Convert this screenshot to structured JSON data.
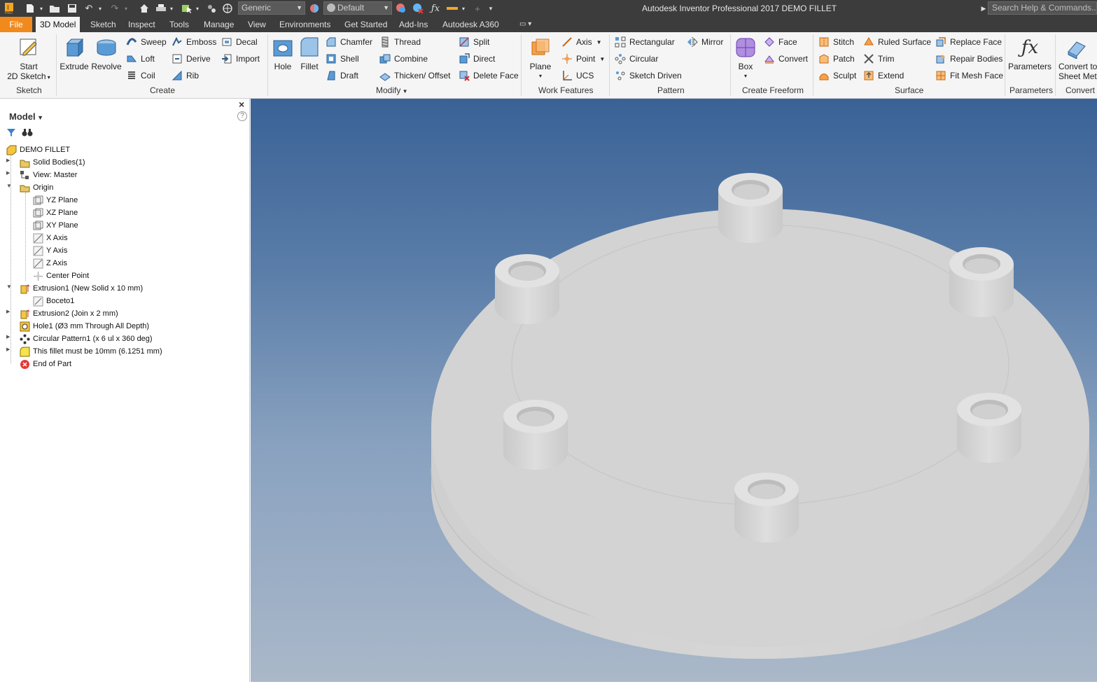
{
  "titlebar": {
    "title": "Autodesk Inventor Professional 2017   DEMO FILLET",
    "material_combo": "Generic",
    "appearance_combo": "Default",
    "search_placeholder": "Search Help & Commands...",
    "colors": {
      "bar": "#3c3c3c",
      "file_tab": "#f08a1d"
    }
  },
  "tabs": [
    "File",
    "3D Model",
    "Sketch",
    "Inspect",
    "Tools",
    "Manage",
    "View",
    "Environments",
    "Get Started",
    "Add-Ins",
    "Autodesk A360"
  ],
  "active_tab": "3D Model",
  "ribbon": {
    "sketch": {
      "group": "Sketch",
      "start_line1": "Start",
      "start_line2": "2D Sketch"
    },
    "create": {
      "group": "Create",
      "extrude": "Extrude",
      "revolve": "Revolve",
      "sweep": "Sweep",
      "loft": "Loft",
      "coil": "Coil",
      "emboss": "Emboss",
      "derive": "Derive",
      "rib": "Rib",
      "decal": "Decal",
      "import": "Import"
    },
    "modify": {
      "group": "Modify",
      "hole": "Hole",
      "fillet": "Fillet",
      "chamfer": "Chamfer",
      "shell": "Shell",
      "draft": "Draft",
      "thread": "Thread",
      "combine": "Combine",
      "thicken": "Thicken/ Offset",
      "split": "Split",
      "direct": "Direct",
      "delete_face": "Delete Face"
    },
    "work_features": {
      "group": "Work Features",
      "plane": "Plane",
      "axis": "Axis",
      "point": "Point",
      "ucs": "UCS"
    },
    "pattern": {
      "group": "Pattern",
      "rectangular": "Rectangular",
      "circular": "Circular",
      "sketch_driven": "Sketch Driven",
      "mirror": "Mirror"
    },
    "freeform": {
      "group": "Create Freeform",
      "box": "Box",
      "face": "Face",
      "convert": "Convert"
    },
    "surface": {
      "group": "Surface",
      "stitch": "Stitch",
      "patch": "Patch",
      "sculpt": "Sculpt",
      "ruled_surface": "Ruled Surface",
      "trim": "Trim",
      "extend": "Extend",
      "replace_face": "Replace Face",
      "repair_bodies": "Repair Bodies",
      "fit_mesh_face": "Fit Mesh Face"
    },
    "parameters": {
      "group": "Parameters",
      "parameters": "Parameters"
    },
    "convert": {
      "group": "Convert",
      "line1": "Convert to",
      "line2": "Sheet Metal"
    }
  },
  "browser": {
    "title": "Model",
    "items": [
      {
        "label": "DEMO FILLET",
        "icon": "part-icon"
      },
      {
        "label": "Solid Bodies(1)",
        "icon": "solid-bodies-icon"
      },
      {
        "label": "View: Master",
        "icon": "view-icon"
      },
      {
        "label": "Origin",
        "icon": "folder-icon"
      },
      {
        "label": "YZ Plane",
        "icon": "plane-icon"
      },
      {
        "label": "XZ Plane",
        "icon": "plane-icon"
      },
      {
        "label": "XY Plane",
        "icon": "plane-icon"
      },
      {
        "label": "X Axis",
        "icon": "axis-icon"
      },
      {
        "label": "Y Axis",
        "icon": "axis-icon"
      },
      {
        "label": "Z Axis",
        "icon": "axis-icon"
      },
      {
        "label": "Center Point",
        "icon": "point-icon"
      },
      {
        "label": "Extrusion1 (New Solid x 10 mm)",
        "icon": "extrude-icon"
      },
      {
        "label": "Boceto1",
        "icon": "sketch-icon"
      },
      {
        "label": "Extrusion2 (Join x 2 mm)",
        "icon": "extrude-icon"
      },
      {
        "label": "Hole1 (Ø3 mm Through All Depth)",
        "icon": "hole-icon"
      },
      {
        "label": "Circular Pattern1 (x 6 ul x 360 deg)",
        "icon": "pattern-icon"
      },
      {
        "label": "This fillet must be 10mm (6.1251 mm)",
        "icon": "fillet-icon"
      },
      {
        "label": "End of Part",
        "icon": "end-of-part-icon"
      }
    ]
  },
  "viewport": {
    "model_color": "#d2d2d2",
    "bg_top": "#3a6296",
    "bg_bottom": "#aab8c9"
  }
}
